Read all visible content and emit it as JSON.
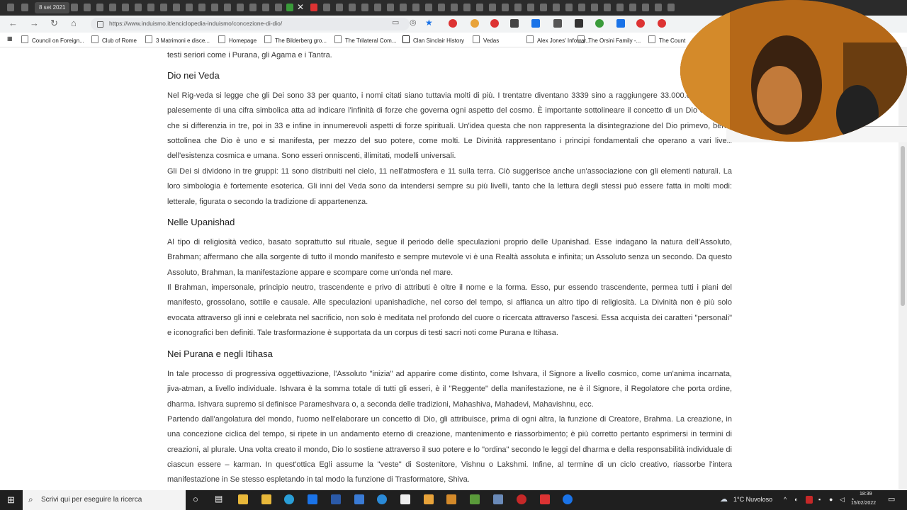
{
  "browser": {
    "date_tab": "8 set 2021",
    "url": "https://www.induismo.it/enciclopedia-induismo/concezione-di-dio/"
  },
  "bookmarks": [
    "Council on Foreign...",
    "Club of Rome",
    "3 Matrimoni e disce...",
    "Homepage",
    "The Bilderberg gro...",
    "The Trilateral Com...",
    "Clan Sinclair History",
    "Vedas",
    "Alex Jones' Infowar...",
    "The Orsini Family -...",
    "The Count"
  ],
  "article": {
    "intro_tail": "testi seriori come i Purana, gli Agama e i Tantra.",
    "sections": [
      {
        "heading": "Dio nei Veda",
        "paragraphs": [
          "Nel Rig-veda si legge che gli Dei sono 33 per quanto, i nomi citati siano tuttavia molti di più. I trentatre diventano 3339 sino a raggiungere 33.000.000. Si tratta palesemente di una cifra simbolica atta ad indicare l'infinità di forze che governa ogni aspetto del cosmo. È importante sottolineare il concetto di un Dio originario che si differenzia in tre, poi in 33 e infine in innumerevoli aspetti di forze spirituali. Un'idea questa che non rappresenta la disintegrazione del Dio primevo, bensì sottolinea che Dio è uno e si manifesta, per mezzo del suo potere, come molti. Le Divinità rappresentano i principi fondamentali che operano a vari livelli dell'esistenza cosmica e umana. Sono esseri onniscenti, illimitati, modelli universali.",
          "Gli Dei si dividono in tre gruppi: 11 sono distribuiti nel cielo, 11 nell'atmosfera e 11 sulla terra. Ciò suggerisce anche un'associazione con gli elementi naturali. La loro simbologia è fortemente esoterica. Gli inni del Veda sono da intendersi sempre su più livelli, tanto che la lettura degli stessi può essere fatta in molti modi: letterale, figurata o secondo la tradizione di appartenenza."
        ]
      },
      {
        "heading": "Nelle Upanishad",
        "paragraphs": [
          "Al tipo di religiosità vedico, basato soprattutto sul rituale, segue il periodo delle speculazioni proprio delle Upanishad. Esse indagano la natura dell'Assoluto, Brahman; affermano che alla sorgente di tutto il mondo manifesto e sempre mutevole vi è una Realtà assoluta e infinita; un Assoluto senza un secondo. Da questo Assoluto, Brahman, la manifestazione appare e scompare come un'onda nel mare.",
          "Il Brahman, impersonale, principio neutro, trascendente e privo di attributi è oltre il nome e la forma. Esso, pur essendo trascendente, permea tutti i piani del manifesto, grossolano, sottile e causale. Alle speculazioni upanishadiche, nel corso del tempo, si affianca un altro tipo di religiosità. La Divinità non è più solo evocata attraverso gli inni e celebrata nel sacrificio, non solo è meditata nel profondo del cuore o ricercata attraverso l'ascesi. Essa acquista dei caratteri \"personali\" e iconografici ben definiti. Tale trasformazione è supportata da un corpus di testi sacri noti come Purana e Itihasa."
        ]
      },
      {
        "heading": "Nei Purana e negli Itihasa",
        "paragraphs": [
          "In tale processo di progressiva oggettivazione, l'Assoluto \"inizia\" ad apparire come distinto, come Ishvara, il Signore a livello cosmico, come un'anima incarnata, jiva-atman, a livello individuale. Ishvara è la somma totale di tutti gli esseri, è il \"Reggente\" della manifestazione, ne è il Signore, il Regolatore che porta ordine, dharma. Ishvara supremo si definisce Parameshvara o, a seconda delle tradizioni, Mahashiva, Mahadevi, Mahavishnu, ecc.",
          "Partendo dall'angolatura del mondo, l'uomo nell'elaborare un concetto di Dio, gli attribuisce, prima di ogni altra, la funzione di Creatore, Brahma. La creazione, in una concezione ciclica del tempo, si ripete in un andamento eterno di creazione, mantenimento e riassorbimento; è più corretto pertanto esprimersi in termini di creazioni, al plurale. Una volta creato il mondo, Dio lo sostiene attraverso il suo potere e lo \"ordina\" secondo le leggi del dharma e della responsabilità individuale di ciascun essere – karman. In quest'ottica Egli assume la \"veste\" di Sostenitore, Vishnu o Lakshmi. Infine, al termine di un ciclo creativo, riassorbe l'intera manifestazione in Se stesso espletando in tal modo la funzione di Trasformatore, Shiva."
        ]
      }
    ]
  },
  "taskbar": {
    "search_placeholder": "Scrivi qui per eseguire la ricerca",
    "weather": "1°C  Nuvoloso",
    "time": "18:39",
    "date": "15/02/2022"
  },
  "colors": {
    "tab_bar": "#2b2b2b",
    "taskbar": "#1f1f1f",
    "webcam": "#b56818"
  }
}
